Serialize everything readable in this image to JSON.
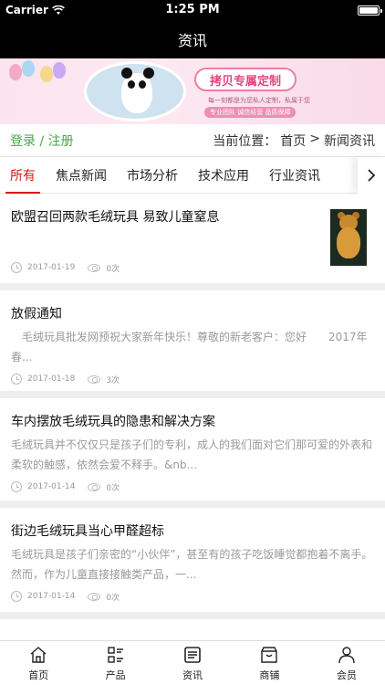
{
  "status": {
    "carrier": "Carrier",
    "time": "1:25 PM"
  },
  "nav": {
    "title": "资讯"
  },
  "banner": {
    "headline": "拷贝专属定制",
    "line1": "每一刻都是为您私人定制，私属于您",
    "line2": "专业团队  诚信经营  品质保障"
  },
  "login_row": {
    "login": "登录",
    "separator": "/",
    "register": "注册",
    "location_label": "当前位置：",
    "home": "首页",
    "arrow": ">",
    "current": "新闻资讯"
  },
  "tabs": [
    {
      "label": "所有",
      "active": true
    },
    {
      "label": "焦点新闻",
      "active": false
    },
    {
      "label": "市场分析",
      "active": false
    },
    {
      "label": "技术应用",
      "active": false
    },
    {
      "label": "行业资讯",
      "active": false
    }
  ],
  "articles": [
    {
      "title": "欧盟召回两款毛绒玩具 易致儿童窒息",
      "summary": "",
      "date": "2017-01-19",
      "views": "0次"
    },
    {
      "title": "放假通知",
      "summary": "　毛绒玩具批发网预祝大家新年快乐！尊敬的新老客户：您好　　2017年春...",
      "date": "2017-01-18",
      "views": "3次"
    },
    {
      "title": "车内摆放毛绒玩具的隐患和解决方案",
      "summary": "毛绒玩具并不仅仅只是孩子们的专利，成人的我们面对它们那可爱的外表和柔软的触感，依然会爱不释手。&nb...",
      "date": "2017-01-14",
      "views": "0次"
    },
    {
      "title": "街边毛绒玩具当心甲醛超标",
      "summary": "毛绒玩具是孩子们亲密的“小伙伴”，甚至有的孩子吃饭睡觉都抱着不离手。然而，作为儿童直接接触类产品，一...",
      "date": "2017-01-14",
      "views": "0次"
    }
  ],
  "bottom_tabs": [
    {
      "label": "首页",
      "icon": "home-icon"
    },
    {
      "label": "产品",
      "icon": "product-grid-icon"
    },
    {
      "label": "资讯",
      "icon": "news-icon"
    },
    {
      "label": "商铺",
      "icon": "shop-icon"
    },
    {
      "label": "会员",
      "icon": "user-icon"
    }
  ],
  "colors": {
    "accent": "#d71818",
    "login_green": "#4aa64a",
    "nav_bg": "#000000"
  }
}
